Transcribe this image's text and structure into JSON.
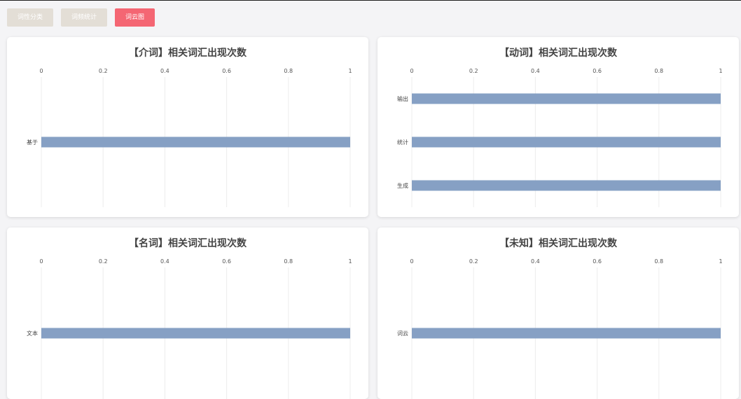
{
  "tabs": [
    {
      "label": "词性分类",
      "active": false
    },
    {
      "label": "词频统计",
      "active": false
    },
    {
      "label": "词云图",
      "active": true
    }
  ],
  "colors": {
    "bar": "#86a0c4",
    "tab_active": "#f46673",
    "tab_inactive": "#e3ded6",
    "grid": "#ececec"
  },
  "chart_data": [
    {
      "type": "bar",
      "orientation": "horizontal",
      "title": "【介词】相关词汇出现次数",
      "categories": [
        "基于"
      ],
      "values": [
        1
      ],
      "xlim": [
        0,
        1
      ],
      "xticks": [
        "0",
        "0.2",
        "0.4",
        "0.6",
        "0.8",
        "1"
      ],
      "grid": true
    },
    {
      "type": "bar",
      "orientation": "horizontal",
      "title": "【动词】相关词汇出现次数",
      "categories": [
        "输出",
        "统计",
        "生成"
      ],
      "values": [
        1,
        1,
        1
      ],
      "xlim": [
        0,
        1
      ],
      "xticks": [
        "0",
        "0.2",
        "0.4",
        "0.6",
        "0.8",
        "1"
      ],
      "grid": true
    },
    {
      "type": "bar",
      "orientation": "horizontal",
      "title": "【名词】相关词汇出现次数",
      "categories": [
        "文本"
      ],
      "values": [
        1
      ],
      "xlim": [
        0,
        1
      ],
      "xticks": [
        "0",
        "0.2",
        "0.4",
        "0.6",
        "0.8",
        "1"
      ],
      "grid": true
    },
    {
      "type": "bar",
      "orientation": "horizontal",
      "title": "【未知】相关词汇出现次数",
      "categories": [
        "词云"
      ],
      "values": [
        1
      ],
      "xlim": [
        0,
        1
      ],
      "xticks": [
        "0",
        "0.2",
        "0.4",
        "0.6",
        "0.8",
        "1"
      ],
      "grid": true
    }
  ]
}
